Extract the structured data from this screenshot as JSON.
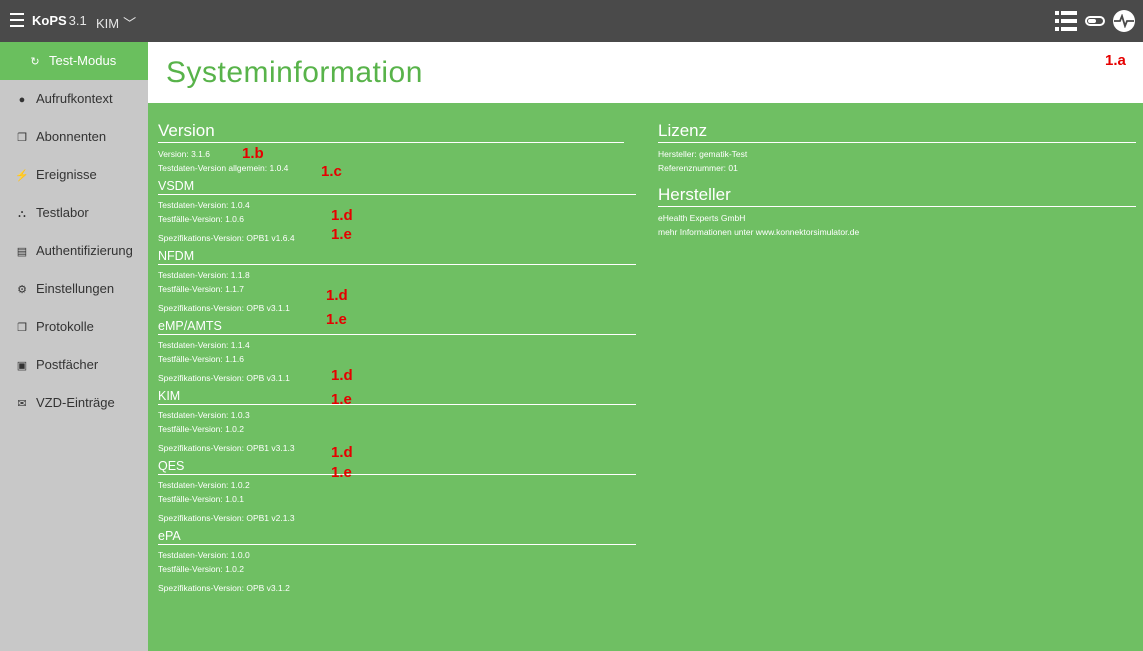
{
  "topbar": {
    "brand_bold": "KoPS",
    "brand_version": "3.1",
    "context": "KIM",
    "icons": [
      "menu-icon",
      "list-icon",
      "toggle-icon",
      "pulse-icon"
    ]
  },
  "sidebar": {
    "items": [
      {
        "label": "Test-Modus",
        "icon": "refresh-icon"
      },
      {
        "label": "Aufrufkontext",
        "icon": "user-icon"
      },
      {
        "label": "Abonnenten",
        "icon": "copy-icon"
      },
      {
        "label": "Ereignisse",
        "icon": "bolt-icon"
      },
      {
        "label": "Testlabor",
        "icon": "binoculars-icon"
      },
      {
        "label": "Authentifizierung",
        "icon": "certificate-icon"
      },
      {
        "label": "Einstellungen",
        "icon": "gear-icon"
      },
      {
        "label": "Protokolle",
        "icon": "copy-icon"
      },
      {
        "label": "Postfächer",
        "icon": "inbox-icon"
      },
      {
        "label": "VZD-Einträge",
        "icon": "envelope-icon"
      }
    ]
  },
  "page": {
    "title": "Systeminformation"
  },
  "version": {
    "title": "Version",
    "version_line": "Version: 3.1.6",
    "testdata_line": "Testdaten-Version allgemein: 1.0.4",
    "sections": [
      {
        "title": "VSDM",
        "lines": [
          "Testdaten-Version: 1.0.4",
          "Testfälle-Version: 1.0.6",
          "Spezifikations-Version: OPB1 v1.6.4"
        ]
      },
      {
        "title": "NFDM",
        "lines": [
          "Testdaten-Version: 1.1.8",
          "Testfälle-Version: 1.1.7",
          "Spezifikations-Version: OPB v3.1.1"
        ]
      },
      {
        "title": "eMP/AMTS",
        "lines": [
          "Testdaten-Version: 1.1.4",
          "Testfälle-Version: 1.1.6",
          "Spezifikations-Version: OPB v3.1.1"
        ]
      },
      {
        "title": "KIM",
        "lines": [
          "Testdaten-Version: 1.0.3",
          "Testfälle-Version: 1.0.2",
          "Spezifikations-Version: OPB1 v3.1.3"
        ]
      },
      {
        "title": "QES",
        "lines": [
          "Testdaten-Version: 1.0.2",
          "Testfälle-Version: 1.0.1",
          "Spezifikations-Version: OPB1 v2.1.3"
        ]
      },
      {
        "title": "ePA",
        "lines": [
          "Testdaten-Version: 1.0.0",
          "Testfälle-Version: 1.0.2",
          "Spezifikations-Version: OPB v3.1.2"
        ]
      }
    ]
  },
  "lizenz": {
    "title": "Lizenz",
    "lines": [
      "Hersteller: gematik-Test",
      "Referenznummer: 01"
    ]
  },
  "hersteller": {
    "title": "Hersteller",
    "lines": [
      "eHealth Experts GmbH",
      "mehr Informationen unter www.konnektorsimulator.de"
    ]
  },
  "annotations": {
    "a": "1.a",
    "b": "1.b",
    "c": "1.c",
    "d": "1.d",
    "e": "1.e"
  },
  "colors": {
    "topbar": "#4a4a4a",
    "sidebar": "#c8c8c8",
    "active": "#6abf5e",
    "main": "#6fbf63",
    "title": "#58b34a",
    "marker": "#e60000"
  }
}
